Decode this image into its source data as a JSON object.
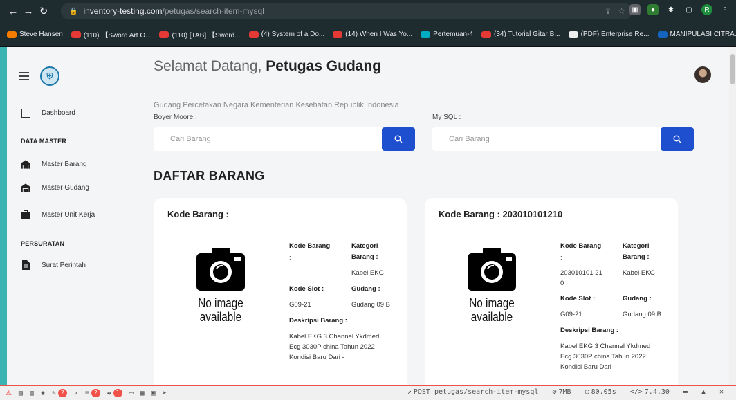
{
  "browser": {
    "url_host": "inventory-testing.com",
    "url_path": "/petugas/search-item-mysql",
    "profile_initial": "R",
    "bookmarks": [
      "Steve Hansen",
      "(110) 【Sword Art O...",
      "(110) [TAB] 【Sword...",
      "(4) System of a Do...",
      "(14) When I Was Yo...",
      "Pertemuan-4",
      "(34) Tutorial Gitar B...",
      "(PDF) Enterprise Re...",
      "MANIPULASI CITRA..."
    ]
  },
  "sidebar": {
    "items": [
      {
        "label": "Dashboard",
        "icon": "dashboard-grid-icon"
      },
      {
        "label": "Master Barang",
        "icon": "warehouse-icon"
      },
      {
        "label": "Master Gudang",
        "icon": "warehouse-icon"
      },
      {
        "label": "Master Unit Kerja",
        "icon": "briefcase-icon"
      },
      {
        "label": "Surat Perintah",
        "icon": "document-icon"
      }
    ],
    "sections": [
      "DATA MASTER",
      "PERSURATAN"
    ]
  },
  "header": {
    "greeting": "Selamat Datang,",
    "role": "Petugas Gudang",
    "subtitle": "Gudang Percetakan Negara Kementerian Kesehatan Republik Indonesia"
  },
  "search": {
    "boyer_label": "Boyer Moore :",
    "mysql_label": "My SQL :",
    "placeholder": "Cari Barang"
  },
  "list_title": "DAFTAR BARANG",
  "no_image": [
    "No image",
    "available"
  ],
  "labels": {
    "kode_barang": "Kode Barang",
    "colon": ":",
    "kategori": "Kategori",
    "barang": "Barang :",
    "kode_slot": "Kode Slot :",
    "gudang": "Gudang :",
    "deskripsi": "Deskripsi Barang :"
  },
  "cards": [
    {
      "title": "Kode Barang :",
      "kode": "",
      "kategori": "Kabel EKG",
      "slot": "G09-21",
      "gudang": "Gudang 09 B",
      "deskripsi": [
        "Kabel EKG 3 Channel Ykdmed",
        "Ecg 3030P china Tahun 2022",
        "Kondisi Baru Dari -"
      ]
    },
    {
      "title": "Kode Barang : 203010101210",
      "kode": [
        "203010101 21",
        "0"
      ],
      "kategori": "Kabel EKG",
      "slot": "G09-21",
      "gudang": "Gudang 09 B",
      "deskripsi": [
        "Kabel EKG 3 Channel Ykdmed",
        "Ecg 3030P china Tahun 2022",
        "Kondisi Baru Dari -"
      ]
    }
  ],
  "debugbar": {
    "badges": [
      "2",
      "2",
      "1"
    ],
    "request": "POST petugas/search-item-mysql",
    "memory": "7MB",
    "time": "80.05s",
    "php": "7.4.30"
  }
}
